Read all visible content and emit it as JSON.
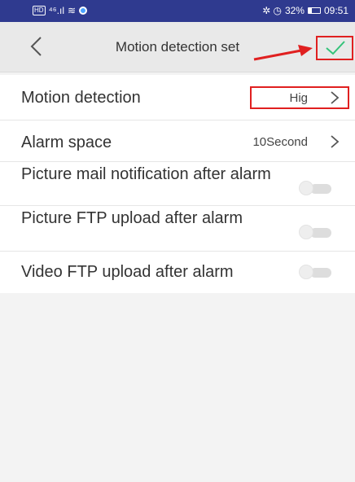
{
  "status_bar": {
    "hd": "HD",
    "signal": "⁴⁶.ıl",
    "wifi": "≋",
    "indicators": "✲ ◷",
    "battery_percent": "32%",
    "battery_level": 0.32,
    "time": "09:51"
  },
  "header": {
    "back_icon": "back-chevron",
    "title": "Motion detection set",
    "confirm_icon": "checkmark",
    "accent": "#34c37a"
  },
  "settings": [
    {
      "label": "Motion detection",
      "value": "Hig",
      "control": "chevron"
    },
    {
      "label": "Alarm space",
      "value": "10Second",
      "control": "chevron"
    },
    {
      "label": "Picture mail notification after alarm",
      "control": "toggle",
      "on": false
    },
    {
      "label": "Picture FTP upload after alarm",
      "control": "toggle",
      "on": false
    },
    {
      "label": "Video FTP upload after alarm",
      "control": "toggle",
      "on": false
    }
  ],
  "annotations": {
    "color": "#e02020"
  }
}
